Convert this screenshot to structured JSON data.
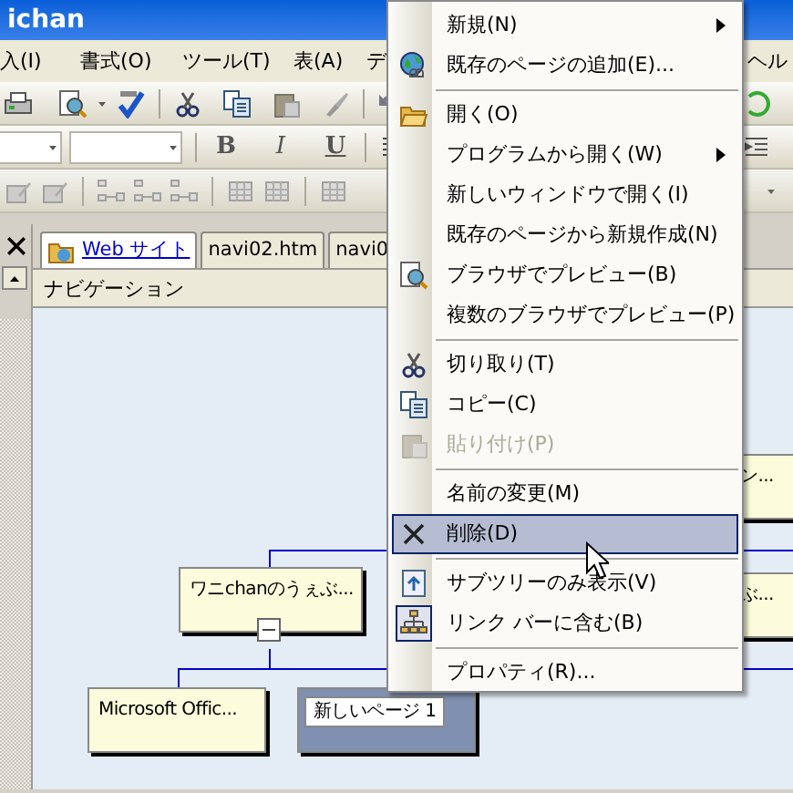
{
  "title_bar": {
    "title": "ichan"
  },
  "menu_bar": [
    {
      "label": "入(I)"
    },
    {
      "label": "書式(O)"
    },
    {
      "label": "ツール(T)"
    },
    {
      "label": "表(A)"
    },
    {
      "label": "デ"
    },
    {
      "label": "ヘル"
    }
  ],
  "format_buttons": [
    {
      "label": "B",
      "kind": "bold"
    },
    {
      "label": "I",
      "kind": "italic"
    },
    {
      "label": "U",
      "kind": "underline"
    }
  ],
  "tabs": [
    {
      "label": "Web サイト",
      "kind": "site",
      "selected": true
    },
    {
      "label": "navi02.htm",
      "kind": "page",
      "selected": false
    },
    {
      "label": "navi0",
      "kind": "page",
      "selected": false
    }
  ],
  "pane_header": "ナビゲーション",
  "navigation": {
    "nodes": [
      {
        "label": "ワニchanのうぇぶ...",
        "selected": false
      },
      {
        "label": "Microsoft Offic...",
        "selected": false
      },
      {
        "label": "新しいページ 1",
        "selected": true
      },
      {
        "label": "ン...",
        "selected": false
      },
      {
        "label": "ぶ...",
        "selected": false
      }
    ]
  },
  "context_menu": {
    "items": [
      {
        "kind": "item",
        "label": "新規(N)",
        "submenu": true,
        "disabled": false,
        "selected": false,
        "checked": false
      },
      {
        "kind": "item",
        "label": "既存のページの追加(E)...",
        "submenu": false,
        "disabled": false,
        "selected": false,
        "checked": false
      },
      {
        "kind": "separator"
      },
      {
        "kind": "item",
        "label": "開く(O)",
        "submenu": false,
        "disabled": false,
        "selected": false,
        "checked": false
      },
      {
        "kind": "item",
        "label": "プログラムから開く(W)",
        "submenu": true,
        "disabled": false,
        "selected": false,
        "checked": false
      },
      {
        "kind": "item",
        "label": "新しいウィンドウで開く(I)",
        "submenu": false,
        "disabled": false,
        "selected": false,
        "checked": false
      },
      {
        "kind": "item",
        "label": "既存のページから新規作成(N)",
        "submenu": false,
        "disabled": false,
        "selected": false,
        "checked": false
      },
      {
        "kind": "item",
        "label": "ブラウザでプレビュー(B)",
        "submenu": false,
        "disabled": false,
        "selected": false,
        "checked": false
      },
      {
        "kind": "item",
        "label": "複数のブラウザでプレビュー(P)",
        "submenu": false,
        "disabled": false,
        "selected": false,
        "checked": false
      },
      {
        "kind": "separator"
      },
      {
        "kind": "item",
        "label": "切り取り(T)",
        "submenu": false,
        "disabled": false,
        "selected": false,
        "checked": false
      },
      {
        "kind": "item",
        "label": "コピー(C)",
        "submenu": false,
        "disabled": false,
        "selected": false,
        "checked": false
      },
      {
        "kind": "item",
        "label": "貼り付け(P)",
        "submenu": false,
        "disabled": true,
        "selected": false,
        "checked": false
      },
      {
        "kind": "separator"
      },
      {
        "kind": "item",
        "label": "名前の変更(M)",
        "submenu": false,
        "disabled": false,
        "selected": false,
        "checked": false
      },
      {
        "kind": "item",
        "label": "削除(D)",
        "submenu": false,
        "disabled": false,
        "selected": true,
        "checked": false
      },
      {
        "kind": "separator"
      },
      {
        "kind": "item",
        "label": "サブツリーのみ表示(V)",
        "submenu": false,
        "disabled": false,
        "selected": false,
        "checked": false
      },
      {
        "kind": "item",
        "label": "リンク バーに含む(B)",
        "submenu": false,
        "disabled": false,
        "selected": false,
        "checked": true
      },
      {
        "kind": "separator"
      },
      {
        "kind": "item",
        "label": "プロパティ(R)...",
        "submenu": false,
        "disabled": false,
        "selected": false,
        "checked": false
      }
    ]
  }
}
